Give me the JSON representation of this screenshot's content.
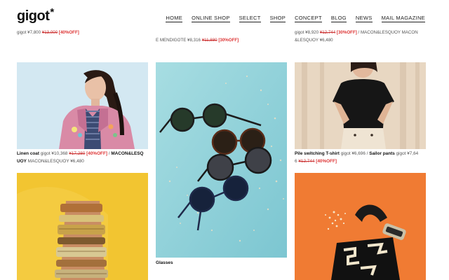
{
  "brand": {
    "logo": "gigot",
    "logo_mark": "*"
  },
  "nav": [
    "HOME",
    "ONLINE SHOP",
    "SELECT",
    "SHOP",
    "CONCEPT",
    "BLOG",
    "NEWS",
    "MAIL MAGAZINE"
  ],
  "top_cut": {
    "col1": [
      "gigot ¥7,800",
      "¥13,000",
      "[40%OFF]"
    ],
    "col2": [
      "E MENDIGOTE ¥8,316",
      "¥11,880",
      "[30%OFF]"
    ],
    "col3": [
      "gigot ¥8,920",
      "¥12,744",
      "[30%OFF]",
      "/ MACON&LESQUOY MACON",
      "&LESQUOY ¥6,480"
    ]
  },
  "items": [
    {
      "name": "Linen coat",
      "line1_rest": "gigot ¥10,368",
      "old": "¥17,280",
      "off": "[40%OFF]",
      "sep": "/",
      "name2": "MACON&LESQ",
      "line2_bold": "UOY",
      "line2_rest": "MACON&LESQUOY ¥6,480"
    },
    {
      "name": "Glasses"
    },
    {
      "name": "Pile switching T-shirt",
      "line1_rest": "gigot ¥6,696 /",
      "name2": "Sailor pants",
      "line1_tail": "gigot ¥7,64",
      "line2_pre": "6",
      "old": "¥12,744",
      "off": "[40%OFF]"
    }
  ],
  "colors": {
    "sky": "#cfe6f2",
    "teal": "#8fcfd8",
    "beige": "#e7d7c2",
    "yellow": "#f2c531",
    "orange": "#f07b33",
    "sale_red": "#d33333"
  }
}
